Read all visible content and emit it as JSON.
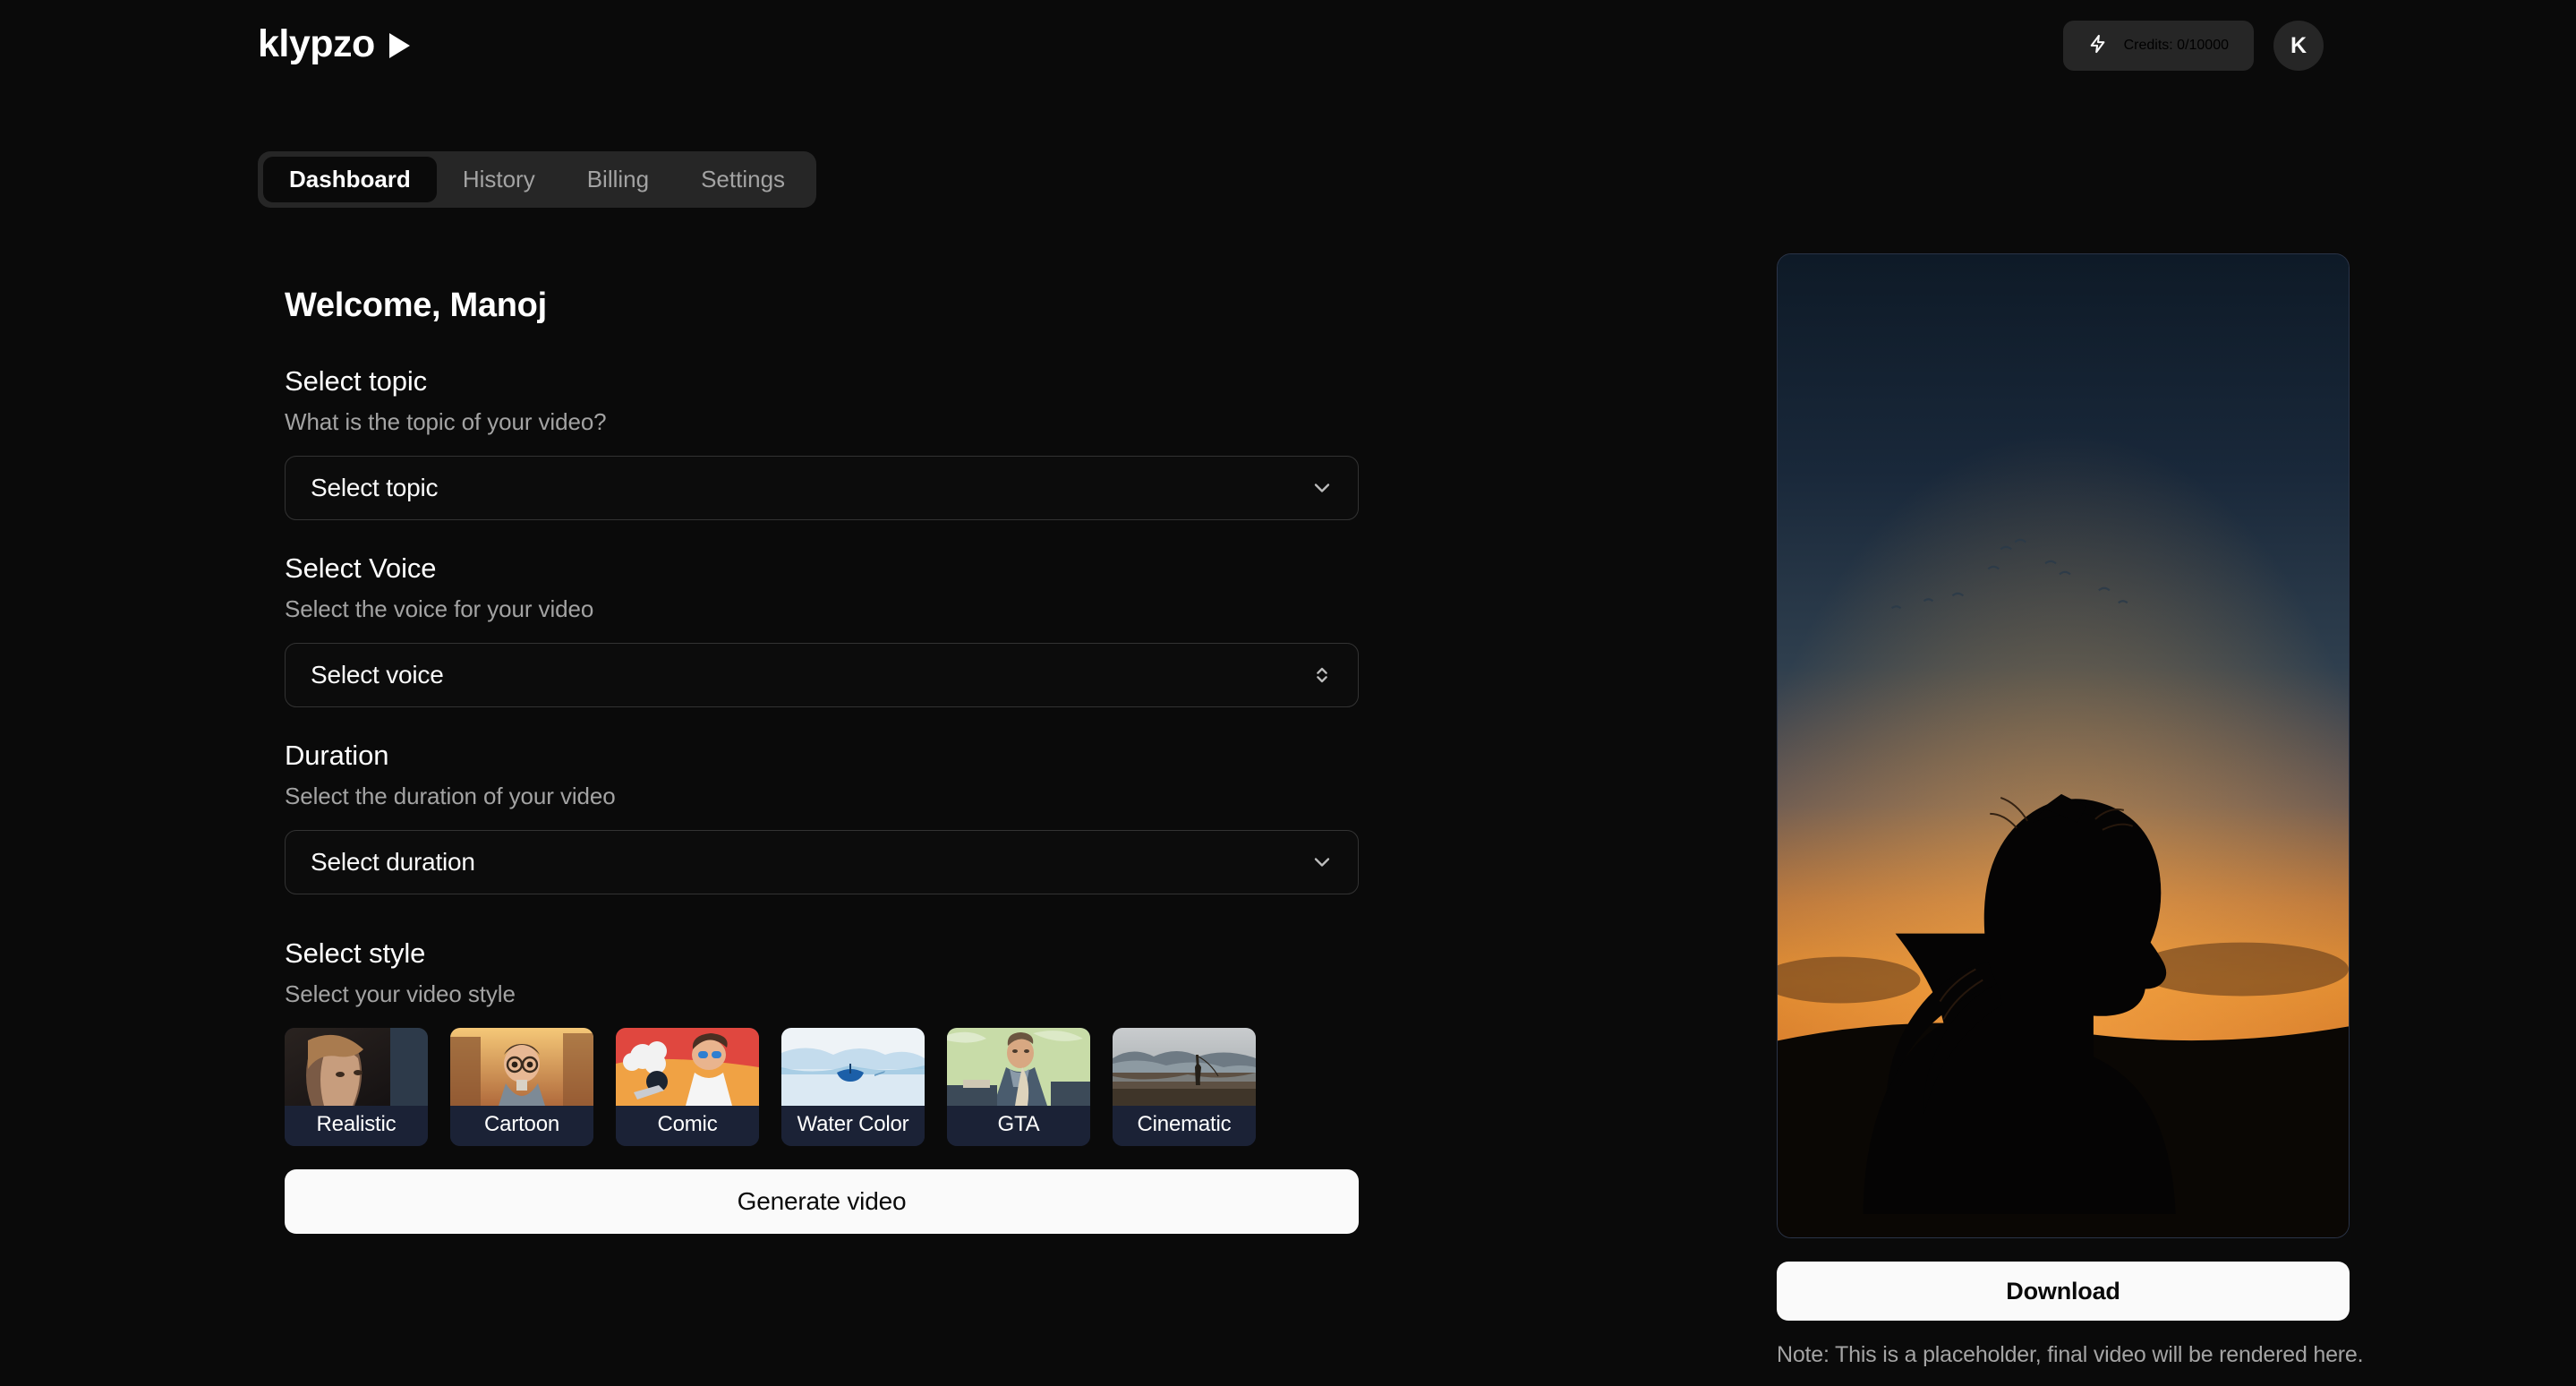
{
  "header": {
    "logo_text": "klypzo",
    "logo_icon": "play-triangle-icon",
    "credits_icon": "lightning-bolt-icon",
    "credits_label": "Credits: 0/10000",
    "avatar_initial": "K"
  },
  "tabs": [
    {
      "label": "Dashboard",
      "active": true
    },
    {
      "label": "History",
      "active": false
    },
    {
      "label": "Billing",
      "active": false
    },
    {
      "label": "Settings",
      "active": false
    }
  ],
  "main": {
    "welcome": "Welcome, Manoj",
    "topic": {
      "title": "Select topic",
      "subtitle": "What is the topic of your video?",
      "value": "Select topic",
      "icon": "chevron-down-icon"
    },
    "voice": {
      "title": "Select Voice",
      "subtitle": "Select the voice for your video",
      "value": "Select voice",
      "icon": "chevrons-up-down-icon"
    },
    "duration": {
      "title": "Duration",
      "subtitle": "Select the duration of your video",
      "value": "Select duration",
      "icon": "chevron-down-icon"
    },
    "style": {
      "title": "Select style",
      "subtitle": "Select your video style",
      "options": [
        {
          "label": "Realistic"
        },
        {
          "label": "Cartoon"
        },
        {
          "label": "Comic"
        },
        {
          "label": "Water Color"
        },
        {
          "label": "GTA"
        },
        {
          "label": "Cinematic"
        }
      ]
    },
    "generate_label": "Generate video"
  },
  "preview": {
    "download_label": "Download",
    "note": "Note: This is a placeholder, final video will be rendered here."
  },
  "colors": {
    "background": "#0a0a0a",
    "surface": "#262626",
    "border": "#333333",
    "text_primary": "#ffffff",
    "text_muted": "#a3a3a3",
    "accent_button": "#fafafa",
    "style_label_bg": "#1b2236"
  }
}
